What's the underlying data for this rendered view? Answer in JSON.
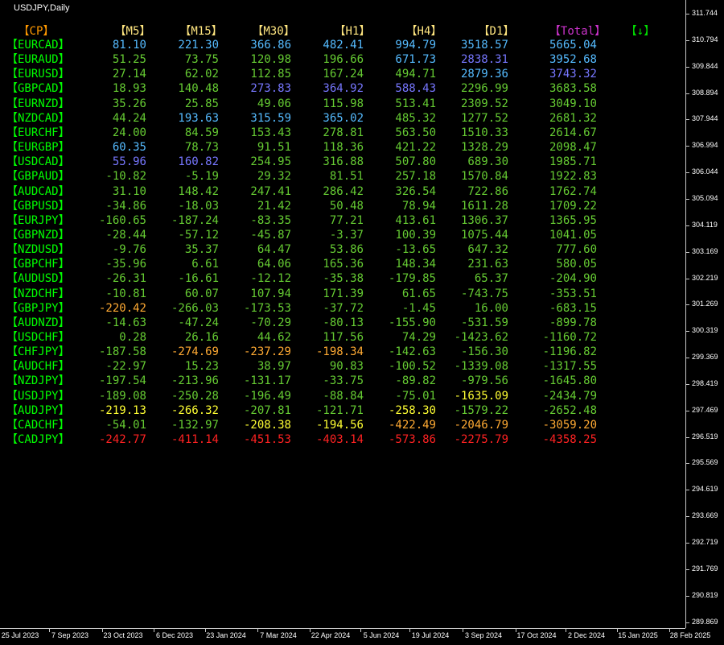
{
  "window": {
    "title": "USDJPY,Daily"
  },
  "colors": {
    "background": "#000000",
    "pair": "#00ff00",
    "cp_header": "#ff9900",
    "tf_header": "#ffe680",
    "total_header": "#cc33cc",
    "arrow_header": "#00dd00",
    "strong": "#55bbff",
    "medium_strong": "#7777ff",
    "positive": "#66cc33",
    "neutral": "#aaee44",
    "weak": "#ffff33",
    "weaker": "#ffaa33",
    "weakest": "#ff2222"
  },
  "table": {
    "headers": {
      "cp": "【CP】",
      "m5": "【M5】",
      "m15": "【M15】",
      "m30": "【M30】",
      "h1": "【H1】",
      "h4": "【H4】",
      "d1": "【D1】",
      "total": "【Total】",
      "sort": "【↓】"
    },
    "rows": [
      {
        "pair": "【EURCAD】",
        "m5": "81.10",
        "m15": "221.30",
        "m30": "366.86",
        "h1": "482.41",
        "h4": "994.79",
        "d1": "3518.57",
        "total": "5665.04",
        "c": [
          "strong",
          "strong",
          "strong",
          "strong",
          "strong",
          "strong",
          "strong"
        ]
      },
      {
        "pair": "【EURAUD】",
        "m5": "51.25",
        "m15": "73.75",
        "m30": "120.98",
        "h1": "196.66",
        "h4": "671.73",
        "d1": "2838.31",
        "total": "3952.68",
        "c": [
          "positive",
          "positive",
          "positive",
          "positive",
          "strong",
          "medium_strong",
          "strong"
        ]
      },
      {
        "pair": "【EURUSD】",
        "m5": "27.14",
        "m15": "62.02",
        "m30": "112.85",
        "h1": "167.24",
        "h4": "494.71",
        "d1": "2879.36",
        "total": "3743.32",
        "c": [
          "positive",
          "positive",
          "positive",
          "positive",
          "positive",
          "strong",
          "medium_strong"
        ]
      },
      {
        "pair": "【GBPCAD】",
        "m5": "18.93",
        "m15": "140.48",
        "m30": "273.83",
        "h1": "364.92",
        "h4": "588.43",
        "d1": "2296.99",
        "total": "3683.58",
        "c": [
          "positive",
          "positive",
          "medium_strong",
          "medium_strong",
          "medium_strong",
          "positive",
          "positive"
        ]
      },
      {
        "pair": "【EURNZD】",
        "m5": "35.26",
        "m15": "25.85",
        "m30": "49.06",
        "h1": "115.98",
        "h4": "513.41",
        "d1": "2309.52",
        "total": "3049.10",
        "c": [
          "positive",
          "positive",
          "positive",
          "positive",
          "positive",
          "positive",
          "positive"
        ]
      },
      {
        "pair": "【NZDCAD】",
        "m5": "44.24",
        "m15": "193.63",
        "m30": "315.59",
        "h1": "365.02",
        "h4": "485.32",
        "d1": "1277.52",
        "total": "2681.32",
        "c": [
          "positive",
          "strong",
          "strong",
          "strong",
          "positive",
          "positive",
          "positive"
        ]
      },
      {
        "pair": "【EURCHF】",
        "m5": "24.00",
        "m15": "84.59",
        "m30": "153.43",
        "h1": "278.81",
        "h4": "563.50",
        "d1": "1510.33",
        "total": "2614.67",
        "c": [
          "positive",
          "positive",
          "positive",
          "positive",
          "positive",
          "positive",
          "positive"
        ]
      },
      {
        "pair": "【EURGBP】",
        "m5": "60.35",
        "m15": "78.73",
        "m30": "91.51",
        "h1": "118.36",
        "h4": "421.22",
        "d1": "1328.29",
        "total": "2098.47",
        "c": [
          "strong",
          "positive",
          "positive",
          "positive",
          "positive",
          "positive",
          "positive"
        ]
      },
      {
        "pair": "【USDCAD】",
        "m5": "55.96",
        "m15": "160.82",
        "m30": "254.95",
        "h1": "316.88",
        "h4": "507.80",
        "d1": "689.30",
        "total": "1985.71",
        "c": [
          "medium_strong",
          "medium_strong",
          "positive",
          "positive",
          "positive",
          "positive",
          "positive"
        ]
      },
      {
        "pair": "【GBPAUD】",
        "m5": "-10.82",
        "m15": "-5.19",
        "m30": "29.32",
        "h1": "81.51",
        "h4": "257.18",
        "d1": "1570.84",
        "total": "1922.83",
        "c": [
          "positive",
          "positive",
          "positive",
          "positive",
          "positive",
          "positive",
          "positive"
        ]
      },
      {
        "pair": "【AUDCAD】",
        "m5": "31.10",
        "m15": "148.42",
        "m30": "247.41",
        "h1": "286.42",
        "h4": "326.54",
        "d1": "722.86",
        "total": "1762.74",
        "c": [
          "positive",
          "positive",
          "positive",
          "positive",
          "positive",
          "positive",
          "positive"
        ]
      },
      {
        "pair": "【GBPUSD】",
        "m5": "-34.86",
        "m15": "-18.03",
        "m30": "21.42",
        "h1": "50.48",
        "h4": "78.94",
        "d1": "1611.28",
        "total": "1709.22",
        "c": [
          "positive",
          "positive",
          "positive",
          "positive",
          "positive",
          "positive",
          "positive"
        ]
      },
      {
        "pair": "【EURJPY】",
        "m5": "-160.65",
        "m15": "-187.24",
        "m30": "-83.35",
        "h1": "77.21",
        "h4": "413.61",
        "d1": "1306.37",
        "total": "1365.95",
        "c": [
          "positive",
          "positive",
          "positive",
          "positive",
          "positive",
          "positive",
          "positive"
        ]
      },
      {
        "pair": "【GBPNZD】",
        "m5": "-28.44",
        "m15": "-57.12",
        "m30": "-45.87",
        "h1": "-3.37",
        "h4": "100.39",
        "d1": "1075.44",
        "total": "1041.05",
        "c": [
          "positive",
          "positive",
          "positive",
          "positive",
          "positive",
          "positive",
          "positive"
        ]
      },
      {
        "pair": "【NZDUSD】",
        "m5": "-9.76",
        "m15": "35.37",
        "m30": "64.47",
        "h1": "53.86",
        "h4": "-13.65",
        "d1": "647.32",
        "total": "777.60",
        "c": [
          "positive",
          "positive",
          "positive",
          "positive",
          "positive",
          "positive",
          "positive"
        ]
      },
      {
        "pair": "【GBPCHF】",
        "m5": "-35.96",
        "m15": "6.61",
        "m30": "64.06",
        "h1": "165.36",
        "h4": "148.34",
        "d1": "231.63",
        "total": "580.05",
        "c": [
          "positive",
          "positive",
          "positive",
          "positive",
          "positive",
          "positive",
          "positive"
        ]
      },
      {
        "pair": "【AUDUSD】",
        "m5": "-26.31",
        "m15": "-16.61",
        "m30": "-12.12",
        "h1": "-35.38",
        "h4": "-179.85",
        "d1": "65.37",
        "total": "-204.90",
        "c": [
          "positive",
          "positive",
          "positive",
          "positive",
          "positive",
          "positive",
          "positive"
        ]
      },
      {
        "pair": "【NZDCHF】",
        "m5": "-10.81",
        "m15": "60.07",
        "m30": "107.94",
        "h1": "171.39",
        "h4": "61.65",
        "d1": "-743.75",
        "total": "-353.51",
        "c": [
          "positive",
          "positive",
          "positive",
          "positive",
          "positive",
          "positive",
          "positive"
        ]
      },
      {
        "pair": "【GBPJPY】",
        "m5": "-220.42",
        "m15": "-266.03",
        "m30": "-173.53",
        "h1": "-37.72",
        "h4": "-1.45",
        "d1": "16.00",
        "total": "-683.15",
        "c": [
          "weaker",
          "positive",
          "positive",
          "positive",
          "positive",
          "positive",
          "positive"
        ]
      },
      {
        "pair": "【AUDNZD】",
        "m5": "-14.63",
        "m15": "-47.24",
        "m30": "-70.29",
        "h1": "-80.13",
        "h4": "-155.90",
        "d1": "-531.59",
        "total": "-899.78",
        "c": [
          "positive",
          "positive",
          "positive",
          "positive",
          "positive",
          "positive",
          "positive"
        ]
      },
      {
        "pair": "【USDCHF】",
        "m5": "0.28",
        "m15": "26.16",
        "m30": "44.62",
        "h1": "117.56",
        "h4": "74.29",
        "d1": "-1423.62",
        "total": "-1160.72",
        "c": [
          "positive",
          "positive",
          "positive",
          "positive",
          "positive",
          "positive",
          "positive"
        ]
      },
      {
        "pair": "【CHFJPY】",
        "m5": "-187.58",
        "m15": "-274.69",
        "m30": "-237.29",
        "h1": "-198.34",
        "h4": "-142.63",
        "d1": "-156.30",
        "total": "-1196.82",
        "c": [
          "positive",
          "weaker",
          "weaker",
          "weaker",
          "positive",
          "positive",
          "positive"
        ]
      },
      {
        "pair": "【AUDCHF】",
        "m5": "-22.97",
        "m15": "15.23",
        "m30": "38.97",
        "h1": "90.83",
        "h4": "-100.52",
        "d1": "-1339.08",
        "total": "-1317.55",
        "c": [
          "positive",
          "positive",
          "positive",
          "positive",
          "positive",
          "positive",
          "positive"
        ]
      },
      {
        "pair": "【NZDJPY】",
        "m5": "-197.54",
        "m15": "-213.96",
        "m30": "-131.17",
        "h1": "-33.75",
        "h4": "-89.82",
        "d1": "-979.56",
        "total": "-1645.80",
        "c": [
          "positive",
          "positive",
          "positive",
          "positive",
          "positive",
          "positive",
          "positive"
        ]
      },
      {
        "pair": "【USDJPY】",
        "m5": "-189.08",
        "m15": "-250.28",
        "m30": "-196.49",
        "h1": "-88.84",
        "h4": "-75.01",
        "d1": "-1635.09",
        "total": "-2434.79",
        "c": [
          "positive",
          "positive",
          "positive",
          "positive",
          "positive",
          "weak",
          "positive"
        ]
      },
      {
        "pair": "【AUDJPY】",
        "m5": "-219.13",
        "m15": "-266.32",
        "m30": "-207.81",
        "h1": "-121.71",
        "h4": "-258.30",
        "d1": "-1579.22",
        "total": "-2652.48",
        "c": [
          "weak",
          "weak",
          "positive",
          "positive",
          "weak",
          "positive",
          "positive"
        ]
      },
      {
        "pair": "【CADCHF】",
        "m5": "-54.01",
        "m15": "-132.97",
        "m30": "-208.38",
        "h1": "-194.56",
        "h4": "-422.49",
        "d1": "-2046.79",
        "total": "-3059.20",
        "c": [
          "positive",
          "positive",
          "weak",
          "weak",
          "weaker",
          "weaker",
          "weaker"
        ]
      },
      {
        "pair": "【CADJPY】",
        "m5": "-242.77",
        "m15": "-411.14",
        "m30": "-451.53",
        "h1": "-403.14",
        "h4": "-573.86",
        "d1": "-2275.79",
        "total": "-4358.25",
        "c": [
          "weakest",
          "weakest",
          "weakest",
          "weakest",
          "weakest",
          "weakest",
          "weakest"
        ]
      }
    ]
  },
  "price_axis": {
    "labels": [
      "311.744",
      "310.794",
      "309.844",
      "308.894",
      "307.944",
      "306.994",
      "306.044",
      "305.094",
      "304.119",
      "303.169",
      "302.219",
      "301.269",
      "300.319",
      "299.369",
      "298.419",
      "297.469",
      "296.519",
      "295.569",
      "294.619",
      "293.669",
      "292.719",
      "291.769",
      "290.819",
      "289.869"
    ]
  },
  "time_axis": {
    "labels": [
      "25 Jul 2023",
      "7 Sep 2023",
      "23 Oct 2023",
      "6 Dec 2023",
      "23 Jan 2024",
      "7 Mar 2024",
      "22 Apr 2024",
      "5 Jun 2024",
      "19 Jul 2024",
      "3 Sep 2024",
      "17 Oct 2024",
      "2 Dec 2024",
      "15 Jan 2025",
      "28 Feb 2025"
    ]
  }
}
